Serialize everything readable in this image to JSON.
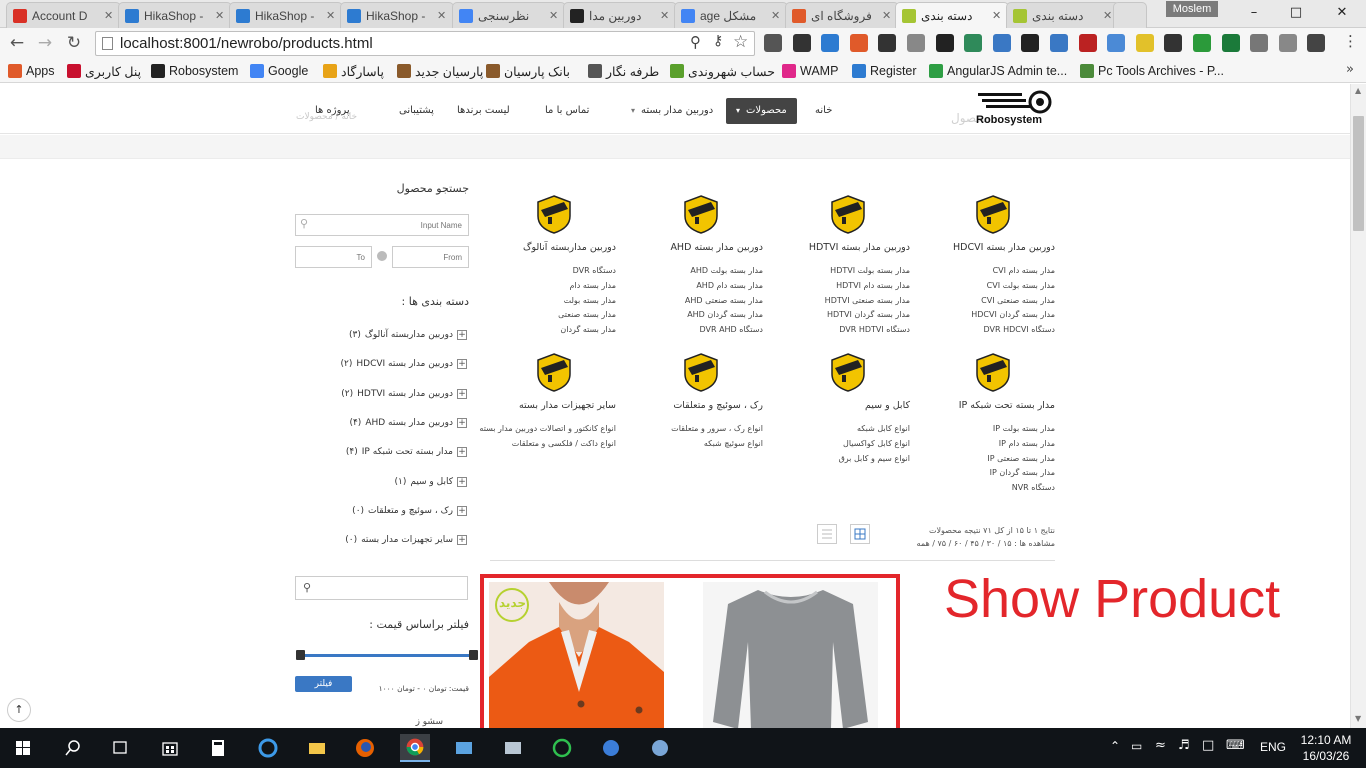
{
  "browser": {
    "tabs": [
      {
        "label": "Account D",
        "color": "#d93025"
      },
      {
        "label": "HikaShop -",
        "color": "#2d7bd1"
      },
      {
        "label": "HikaShop -",
        "color": "#2d7bd1"
      },
      {
        "label": "HikaShop -",
        "color": "#2d7bd1"
      },
      {
        "label": "نظرسنجی",
        "color": "#4285f4"
      },
      {
        "label": "دوربین مدا",
        "color": "#222222"
      },
      {
        "label": "age مشکل",
        "color": "#4285f4"
      },
      {
        "label": "فروشگاه ای",
        "color": "#e05a2a"
      },
      {
        "label": "دسته بندی",
        "color": "#a5c534"
      },
      {
        "label": "دسته بندی",
        "color": "#a5c534"
      }
    ],
    "user_chip": "Moslem",
    "url": "localhost:8001/newrobo/products.html",
    "bookmarks": [
      {
        "label": "Apps",
        "color": "#e05a2a"
      },
      {
        "label": "پنل کاربری",
        "color": "#c8102e"
      },
      {
        "label": "Robosystem",
        "color": "#222222"
      },
      {
        "label": "Google",
        "color": "#4285f4"
      },
      {
        "label": "پاسارگاد",
        "color": "#e8a317"
      },
      {
        "label": "پارسیان جدید",
        "color": "#8a5a2b"
      },
      {
        "label": "بانک پارسیان",
        "color": "#8a5a2b"
      },
      {
        "label": "طرفه نگار",
        "color": "#555555"
      },
      {
        "label": "حساب شهروندی",
        "color": "#5aa02c"
      },
      {
        "label": "WAMP",
        "color": "#e0288a"
      },
      {
        "label": "Register",
        "color": "#2d7bd1"
      },
      {
        "label": "AngularJS Admin te...",
        "color": "#2e9e44"
      },
      {
        "label": "Pc Tools Archives - P...",
        "color": "#4b8a3a"
      }
    ]
  },
  "site": {
    "logo_text": "Robosystem",
    "ghost_title": "محصول",
    "ghost_breadcrumb": "خانه / محصولات",
    "menu": [
      {
        "label": "خانه"
      },
      {
        "label": "محصولات"
      },
      {
        "label": "دوربین مدار بسته"
      },
      {
        "label": "تماس با ما"
      },
      {
        "label": "لیست برندها"
      },
      {
        "label": "پشتیبانی"
      },
      {
        "label": "پروژه ها"
      }
    ]
  },
  "categories": [
    {
      "title": "دوربین مدار بسته HDCVI",
      "items": [
        "مدار بسته دام CVI",
        "مدار بسته بولت CVI",
        "مدار بسته صنعتی CVI",
        "مدار بسته گردان HDCVI",
        "دستگاه DVR HDCVI"
      ]
    },
    {
      "title": "دوربین مدار بسته HDTVI",
      "items": [
        "مدار بسته بولت HDTVI",
        "مدار بسته دام HDTVI",
        "مدار بسته صنعتی HDTVI",
        "مدار بسته گردان HDTVI",
        "دستگاه DVR HDTVI"
      ]
    },
    {
      "title": "دوربین مدار بسته AHD",
      "items": [
        "مدار بسته بولت AHD",
        "مدار بسته دام AHD",
        "مدار بسته صنعتی AHD",
        "مدار بسته گردان AHD",
        "دستگاه DVR AHD"
      ]
    },
    {
      "title": "دوربین مداربسته آنالوگ",
      "items": [
        "دستگاه DVR",
        "مدار بسته دام",
        "مدار بسته بولت",
        "مدار بسته صنعتی",
        "مدار بسته گردان"
      ]
    },
    {
      "title": "مدار بسته تحت شبکه IP",
      "items": [
        "مدار بسته بولت IP",
        "مدار بسته دام IP",
        "مدار بسته صنعتی IP",
        "مدار بسته گردان IP",
        "دستگاه NVR"
      ]
    },
    {
      "title": "کابل و سیم",
      "items": [
        "انواع کابل شبکه",
        "انواع کابل کواکسیال",
        "انواع سیم و کابل برق"
      ]
    },
    {
      "title": "رک ، سوئیچ و متعلقات",
      "items": [
        "انواع رک ، سرور و متعلقات",
        "انواع سوئیچ شبکه"
      ]
    },
    {
      "title": "سایر تجهیزات مدار بسته",
      "items": [
        "انواع کانکتور و اتصالات دوربین مدار بسته",
        "انواع داکت / فلکسی و متعلقات"
      ]
    }
  ],
  "results": {
    "summary": "نتایج ۱ تا ۱۵ از کل ۷۱ نتیجه محصولات",
    "per_page": "مشاهده ها :   ۱۵ / ۳۰ / ۴۵ / ۶۰ / ۷۵ / همه"
  },
  "sidebar": {
    "search_title": "جستجو محصول",
    "name_placeholder": "Input Name",
    "from_placeholder": "From",
    "to_placeholder": "To",
    "categories_title": "دسته بندی ها :",
    "category_items": [
      {
        "label": "دوربین مداربسته آنالوگ",
        "count": "(۳)"
      },
      {
        "label": "دوربین مدار بسته HDCVI",
        "count": "(۲)"
      },
      {
        "label": "دوربین مدار بسته HDTVI",
        "count": "(۲)"
      },
      {
        "label": "دوربین مدار بسته AHD",
        "count": "(۴)"
      },
      {
        "label": "مدار بسته تحت شبکه IP",
        "count": "(۴)"
      },
      {
        "label": "کابل و سیم",
        "count": "(۱)"
      },
      {
        "label": "رک ، سوئیچ و متعلقات",
        "count": "(۰)"
      },
      {
        "label": "سایر تجهیزات مدار بسته",
        "count": "(۰)"
      }
    ],
    "price_filter_title": "فیلتر براساس قیمت :",
    "price_range_low_fraction": 0.0,
    "price_range_high_fraction": 1.0,
    "filter_button": "فیلتر",
    "price_text": "قیمت: تومان ۰ - تومان ۱۰۰۰",
    "more_text": "سشو ز"
  },
  "products": {
    "new_badge": "جدید"
  },
  "annotation": "Show Product",
  "taskbar": {
    "lang": "ENG",
    "time": "12:10 AM",
    "date": "16/03/26"
  },
  "colors": {
    "accent_blue": "#3a78c4",
    "annotation_red": "#e3262b",
    "menu_active": "#444444",
    "category_icon_yellow": "#f2c400"
  }
}
